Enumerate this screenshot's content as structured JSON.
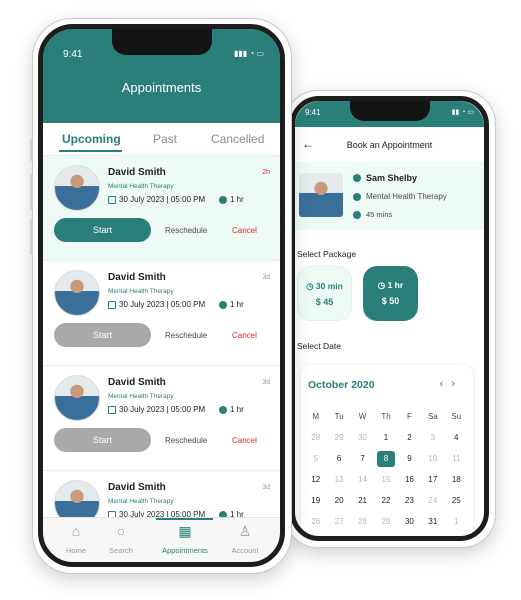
{
  "left": {
    "status_time": "9:41",
    "title": "Appointments",
    "tabs": [
      "Upcoming",
      "Past",
      "Cancelled"
    ],
    "cards": [
      {
        "name": "David Smith",
        "specialty": "Mental Health Therapy",
        "datetime": "30 July 2023 | 05:00 PM",
        "duration": "1 hr",
        "tag": "2h",
        "start": "Start",
        "reschedule": "Reschedule",
        "cancel": "Cancel"
      },
      {
        "name": "David Smith",
        "specialty": "Mental Health Therapy",
        "datetime": "30 July 2023 | 05:00 PM",
        "duration": "1 hr",
        "tag": "3d",
        "start": "Start",
        "reschedule": "Reschedule",
        "cancel": "Cancel"
      },
      {
        "name": "David Smith",
        "specialty": "Mental Health Therapy",
        "datetime": "30 July 2023 | 05:00 PM",
        "duration": "1 hr",
        "tag": "3d",
        "start": "Start",
        "reschedule": "Reschedule",
        "cancel": "Cancel"
      },
      {
        "name": "David Smith",
        "specialty": "Mental Health Therapy",
        "datetime": "30 July 2023 | 05:00 PM",
        "duration": "1 hr",
        "tag": "3d"
      }
    ],
    "nav": [
      "Home",
      "Search",
      "Appointments",
      "Account"
    ]
  },
  "right": {
    "status_time": "9:41",
    "title": "Book an Appointment",
    "doctor": {
      "name": "Sam Shelby",
      "specialty": "Mental Health Therapy",
      "duration": "45 mins"
    },
    "select_package": "Select Package",
    "packages": [
      {
        "duration": "30 min",
        "price": "$ 45"
      },
      {
        "duration": "1 hr",
        "price": "$ 50"
      }
    ],
    "select_date": "Select Date",
    "month": "October 2020",
    "weekdays": [
      "M",
      "Tu",
      "W",
      "Th",
      "F",
      "Sa",
      "Su"
    ],
    "weeks": [
      [
        "28",
        "29",
        "30",
        "1",
        "2",
        "3",
        "4"
      ],
      [
        "5",
        "6",
        "7",
        "8",
        "9",
        "10",
        "11"
      ],
      [
        "12",
        "13",
        "14",
        "15",
        "16",
        "17",
        "18"
      ],
      [
        "19",
        "20",
        "21",
        "22",
        "23",
        "24",
        "25"
      ],
      [
        "26",
        "27",
        "28",
        "29",
        "30",
        "31",
        "1"
      ]
    ]
  }
}
